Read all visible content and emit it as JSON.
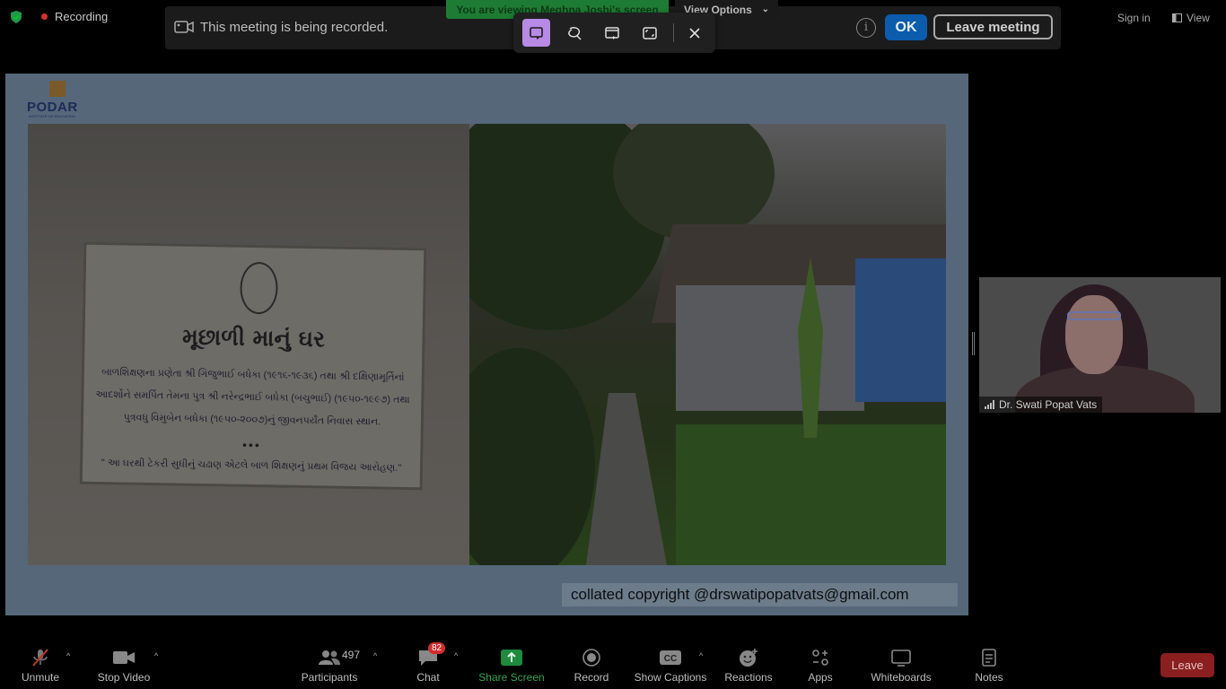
{
  "status": {
    "recording_label": "Recording"
  },
  "banner": {
    "message": "This meeting is being recorded.",
    "ok_label": "OK",
    "leave_meeting_label": "Leave meeting"
  },
  "screen_share": {
    "viewing_text": "You are viewing Meghna Joshi's screen",
    "view_options_label": "View Options"
  },
  "top_right": {
    "sign_in_label": "Sign in",
    "view_label": "View"
  },
  "slide": {
    "logo_text": "PODAR",
    "logo_subtext": "INSTITUTE OF EDUCATION",
    "plaque_title": "મૂછાળી માનું ઘર",
    "plaque_body": "બાળશિક્ષણના પ્રણેતા શ્રી ગિજુભાઈ બધેકા (૧૯૧૬-૧૯૩૬) તથા શ્રી દક્ષિણામૂર્તિનાં આદર્શોને સમર્પિત તેમના પુત્ર શ્રી નરેન્દ્રભાઈ બધેકા (બચુભાઈ) (૧૯૫૦-૧૯૯૭) તથા પુત્રવધુ વિમુબેન બધેકા (૧૯૫૦-૨૦૦૭)નું જીવનપર્યંત નિવાસ સ્થાન.",
    "plaque_dots": "•••",
    "plaque_quote": "\" આ ઘરથી ટેકરી સુધીનું ચઢાણ એટલે બાળ શિક્ષણનું પ્રથમ વિજય આરોહણ.\"",
    "copyright": "collated copyright @drswatipopatvats@gmail.com"
  },
  "participant_tile": {
    "name": "Dr. Swati Popat Vats"
  },
  "toolbar": {
    "unmute": "Unmute",
    "stop_video": "Stop Video",
    "participants": "Participants",
    "participants_count": "497",
    "chat": "Chat",
    "chat_badge": "82",
    "share_screen": "Share Screen",
    "record": "Record",
    "show_captions": "Show Captions",
    "reactions": "Reactions",
    "apps": "Apps",
    "whiteboards": "Whiteboards",
    "notes": "Notes",
    "leave": "Leave"
  },
  "colors": {
    "share_green": "#2ea44f",
    "ok_blue": "#0b5cad",
    "leave_red": "#8b1f1f",
    "snip_active": "#b78ae6"
  }
}
